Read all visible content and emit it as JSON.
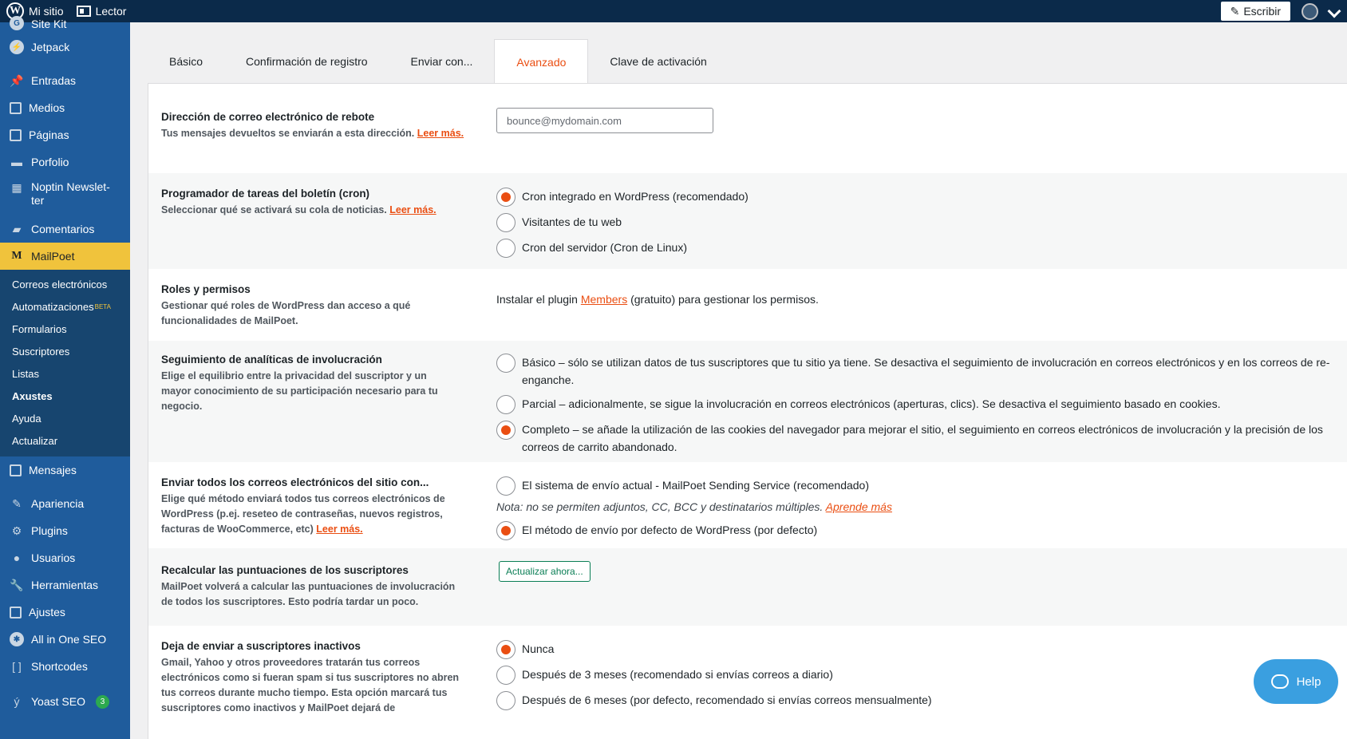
{
  "adminbar": {
    "site": "Mi sitio",
    "reader": "Lector",
    "write": "Escribir"
  },
  "sidebar": {
    "items_top": [
      {
        "label": "Site Kit",
        "icon": "site-kit-icon"
      },
      {
        "label": "Jetpack",
        "icon": "jetpack-icon"
      },
      {
        "label": "Entradas",
        "icon": "pin-icon"
      },
      {
        "label": "Medios",
        "icon": "media-icon"
      },
      {
        "label": "Páginas",
        "icon": "pages-icon"
      },
      {
        "label": "Porfolio",
        "icon": "portfolio-icon"
      },
      {
        "label": "Noptin Newslet-ter",
        "icon": "newsletter-icon"
      },
      {
        "label": "Comentarios",
        "icon": "comments-icon"
      }
    ],
    "active": "MailPoet",
    "submenu": [
      "Correos electrónicos",
      "Automatizaciones",
      "Formularios",
      "Suscriptores",
      "Listas",
      "Axustes",
      "Ayuda",
      "Actualizar"
    ],
    "beta": "BETA",
    "items_bottom": [
      {
        "label": "Mensajes",
        "icon": "messages-icon"
      },
      {
        "label": "Apariencia",
        "icon": "appearance-icon"
      },
      {
        "label": "Plugins",
        "icon": "plugins-icon"
      },
      {
        "label": "Usuarios",
        "icon": "users-icon"
      },
      {
        "label": "Herramientas",
        "icon": "tools-icon"
      },
      {
        "label": "Ajustes",
        "icon": "settings-icon"
      },
      {
        "label": "All in One SEO",
        "icon": "aioseo-icon"
      },
      {
        "label": "Shortcodes",
        "icon": "shortcodes-icon"
      },
      {
        "label": "Yoast SEO",
        "icon": "yoast-icon",
        "badge": "3"
      }
    ]
  },
  "tabs": [
    "Básico",
    "Confirmación de registro",
    "Enviar con...",
    "Avanzado",
    "Clave de activación"
  ],
  "bounce": {
    "title": "Dirección de correo electrónico de rebote",
    "desc": "Tus mensajes devueltos se enviarán a esta dirección.",
    "link": "Leer más.",
    "placeholder": "bounce@mydomain.com"
  },
  "cron": {
    "title": "Programador de tareas del boletín (cron)",
    "desc": "Seleccionar qué se activará su cola de noticias.",
    "link": "Leer más.",
    "options": [
      "Cron integrado en WordPress (recomendado)",
      "Visitantes de tu web",
      "Cron del servidor (Cron de Linux)"
    ]
  },
  "roles": {
    "title": "Roles y permisos",
    "desc": "Gestionar qué roles de WordPress dan acceso a qué funcionalidades de MailPoet.",
    "pre": "Instalar el plugin",
    "link": "Members",
    "post": "(gratuito) para gestionar los permisos."
  },
  "tracking": {
    "title": "Seguimiento de analíticas de involucración",
    "desc": "Elige el equilibrio entre la privacidad del suscriptor y un mayor conocimiento de su participación necesario para tu negocio.",
    "options": [
      "Básico – sólo se utilizan datos de tus suscriptores que tu sitio ya tiene. Se desactiva el seguimiento de involucración en correos electrónicos y en los correos de re-enganche.",
      "Parcial – adicionalmente, se sigue la involucración en correos electrónicos (aperturas, clics). Se desactiva el seguimiento basado en cookies.",
      "Completo – se añade la utilización de las cookies del navegador para mejorar el sitio, el seguimiento en correos electrónicos de involucración y la precisión de los correos de carrito abandonado."
    ]
  },
  "sendall": {
    "title": "Enviar todos los correos electrónicos del sitio con...",
    "desc": "Elige qué método enviará todos tus correos electrónicos de WordPress (p.ej. reseteo de contraseñas, nuevos registros, facturas de WooCommerce, etc)",
    "link": "Leer más.",
    "opt1": "El sistema de envío actual - MailPoet Sending Service (recomendado)",
    "note": "Nota: no se permiten adjuntos, CC, BCC y destinatarios múltiples.",
    "note_link": "Aprende más",
    "opt2": "El método de envío por defecto de WordPress (por defecto)"
  },
  "recalc": {
    "title": "Recalcular las puntuaciones de los suscriptores",
    "desc": "MailPoet volverá a calcular las puntuaciones de involucración de todos los suscriptores. Esto podría tardar un poco.",
    "button": "Actualizar ahora..."
  },
  "inactive": {
    "title": "Deja de enviar a suscriptores inactivos",
    "desc": "Gmail, Yahoo y otros proveedores tratarán tus correos electrónicos como si fueran spam si tus suscriptores no abren tus correos durante mucho tiempo. Esta opción marcará tus suscriptores como inactivos y MailPoet dejará de",
    "options": [
      "Nunca",
      "Después de 3 meses (recomendado si envías correos a diario)",
      "Después de 6 meses (por defecto, recomendado si envías correos mensualmente)"
    ]
  },
  "help": "Help",
  "colors": {
    "accent": "#ea4e12",
    "sidebar": "#1f5c9c",
    "adminbar": "#0b2a4a",
    "active_menu": "#f0c33c"
  }
}
